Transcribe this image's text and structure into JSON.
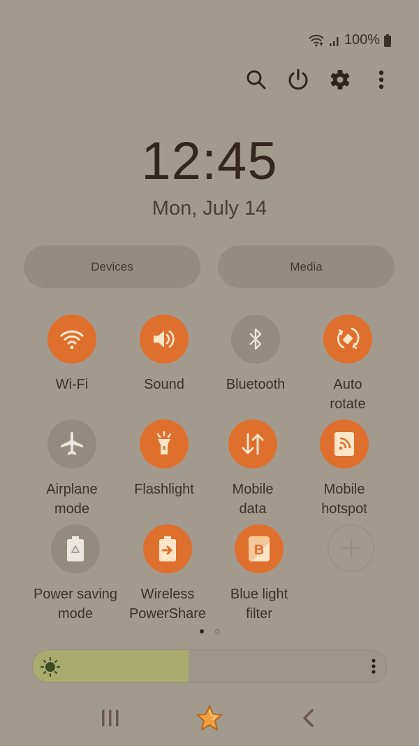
{
  "status_bar": {
    "wifi_icon": "wifi-calling-icon",
    "signal_icon": "signal-bars-icon",
    "battery_percent": "100%",
    "battery_icon": "battery-full-icon"
  },
  "toolbar": {
    "buttons": [
      {
        "name": "search",
        "icon": "search-icon"
      },
      {
        "name": "power",
        "icon": "power-icon"
      },
      {
        "name": "settings",
        "icon": "gear-icon"
      },
      {
        "name": "more",
        "icon": "more-vertical-icon"
      }
    ]
  },
  "clock": {
    "time": "12:45",
    "date": "Mon, July 14"
  },
  "panels": {
    "devices_label": "Devices",
    "media_label": "Media"
  },
  "tiles": [
    {
      "label": "Wi-Fi",
      "state": "on",
      "icon": "wifi-icon"
    },
    {
      "label": "Sound",
      "state": "on",
      "icon": "speaker-icon"
    },
    {
      "label": "Bluetooth",
      "state": "off",
      "icon": "bluetooth-icon"
    },
    {
      "label": "Auto\nrotate",
      "state": "on",
      "icon": "auto-rotate-icon"
    },
    {
      "label": "Airplane\nmode",
      "state": "off",
      "icon": "airplane-icon"
    },
    {
      "label": "Flashlight",
      "state": "on",
      "icon": "flashlight-icon"
    },
    {
      "label": "Mobile\ndata",
      "state": "on",
      "icon": "mobile-data-icon"
    },
    {
      "label": "Mobile\nhotspot",
      "state": "on",
      "icon": "hotspot-icon"
    },
    {
      "label": "Power saving\nmode",
      "state": "off",
      "icon": "power-saving-icon"
    },
    {
      "label": "Wireless\nPowerShare",
      "state": "on",
      "icon": "wireless-powershare-icon"
    },
    {
      "label": "Blue light\nfilter",
      "state": "on",
      "icon": "blue-light-filter-icon"
    },
    {
      "label": "",
      "state": "add",
      "icon": "plus-icon"
    }
  ],
  "pagination": {
    "current_page": 1,
    "total_pages": 2
  },
  "brightness": {
    "level_percent": 44,
    "icon": "sun-icon",
    "more_icon": "more-vertical-icon"
  },
  "navbar": {
    "recents_icon": "recents-icon",
    "home_icon": "star-home-icon",
    "back_icon": "back-chevron-icon"
  },
  "colors": {
    "background": "#a39a8e",
    "tile_on": "#df6f2d",
    "tile_off": "#938b80",
    "icon_light": "#fde6c8",
    "brightness_fill": "#a9ab6e",
    "home_star": "#f0a040"
  }
}
